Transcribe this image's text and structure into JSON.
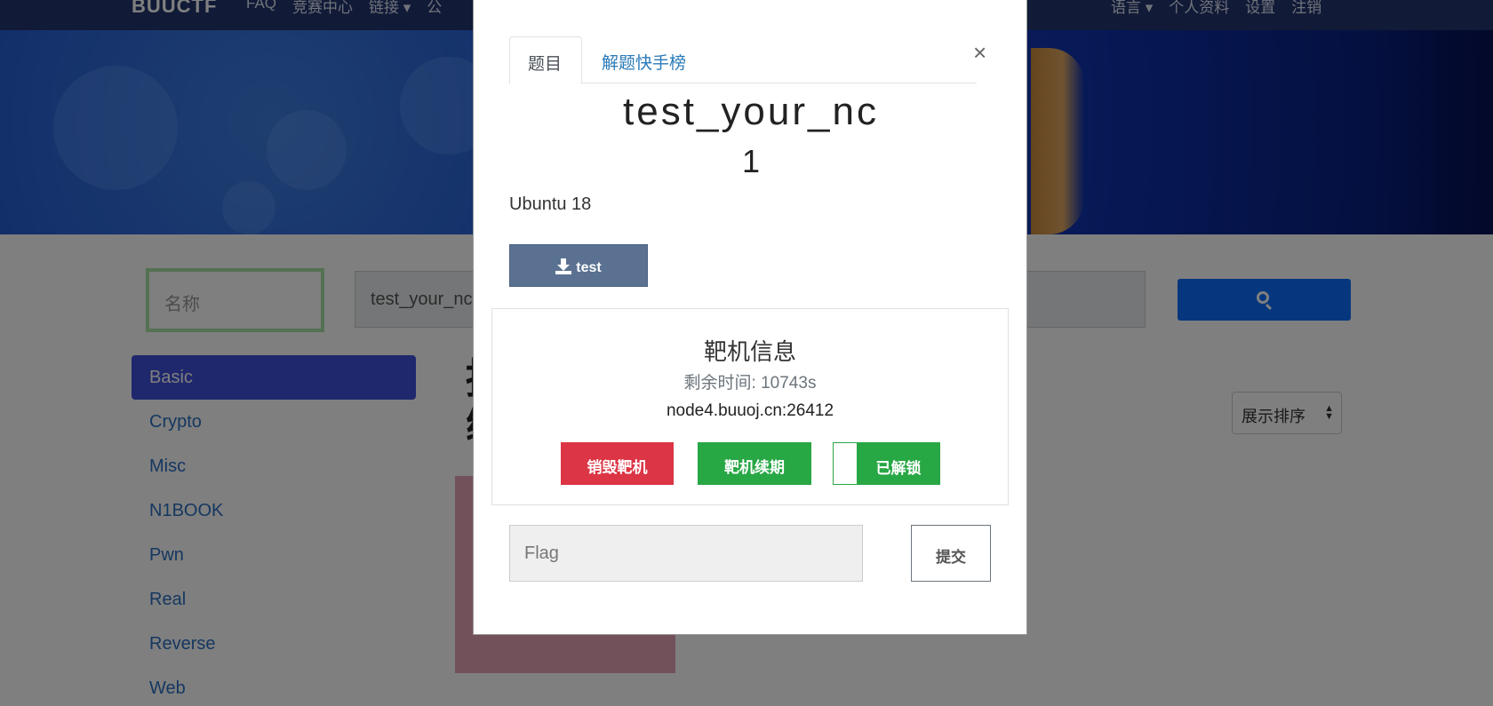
{
  "navbar": {
    "brand": "BUUCTF",
    "links": [
      "FAQ",
      "竞赛中心",
      "链接 ▾",
      "公"
    ],
    "right_links": [
      "语言 ▾",
      "个人资料",
      "设置",
      "注销"
    ]
  },
  "search": {
    "name_placeholder": "名称",
    "term_value": "test_your_nc",
    "icon": "search-icon"
  },
  "categories": [
    "Basic",
    "Crypto",
    "Misc",
    "N1BOOK",
    "Pwn",
    "Real",
    "Reverse",
    "Web"
  ],
  "active_category": "Basic",
  "content": {
    "title_partial": "挑\n练"
  },
  "sort": {
    "label": "展示排序"
  },
  "modal": {
    "tabs": [
      "题目",
      "解题快手榜"
    ],
    "active_tab": "题目",
    "close": "×",
    "challenge_name": "test_your_nc",
    "challenge_value": "1",
    "description": "Ubuntu 18",
    "file_button": "test",
    "instance": {
      "title": "靶机信息",
      "time_left": "剩余时间: 10743s",
      "host": "node4.buuoj.cn:26412",
      "destroy_label": "销毁靶机",
      "renew_label": "靶机续期",
      "unlock_label": "已解锁"
    },
    "flag_placeholder": "Flag",
    "submit_label": "提交"
  },
  "colors": {
    "navbar": "#23346e",
    "primary": "#0d6efd",
    "danger": "#dc3545",
    "success": "#28a745",
    "file_button": "#5a7191",
    "active_category": "#3f51d9"
  }
}
